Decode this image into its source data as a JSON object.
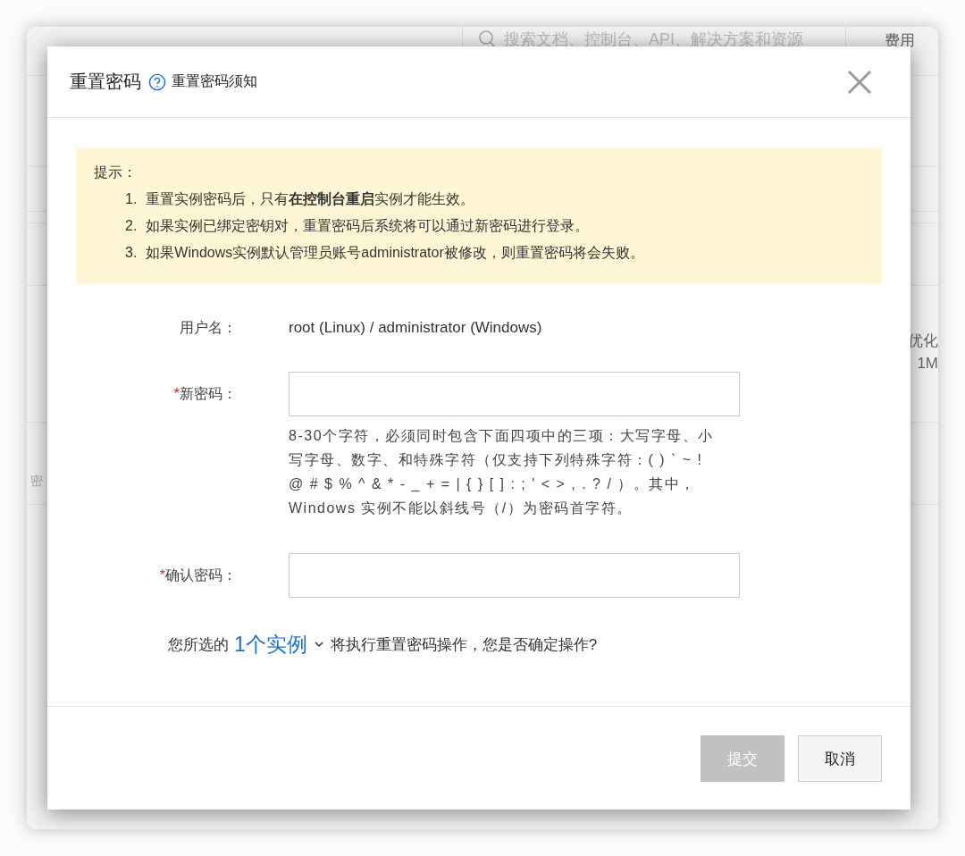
{
  "background": {
    "search_placeholder": "搜索文档、控制台、API、解决方案和资源",
    "header_link": "费用",
    "left_text": "密",
    "right_texts": [
      "优化",
      "1M"
    ]
  },
  "dialog": {
    "title": "重置密码",
    "help_link": "重置密码须知",
    "required_mark": "*",
    "notice": {
      "heading": "提示：",
      "items": [
        {
          "number": "1.",
          "text": "重置实例密码后，只有**在控制台重启**实例才能生效。"
        },
        {
          "number": "2.",
          "text": "如果实例已绑定密钥对，重置密码后系统将可以通过新密码进行登录。"
        },
        {
          "number": "3.",
          "text": "如果Windows实例默认管理员账号administrator被修改，则重置密码将会失败。"
        }
      ]
    },
    "fields": [
      {
        "kind": "text",
        "label": "用户名：",
        "required": false,
        "value": "root (Linux) / administrator (Windows)"
      },
      {
        "kind": "password",
        "label": "新密码：",
        "required": true,
        "hint": "8-30个字符，必须同时包含下面四项中的三项：大写字母、小写字母、数字、和特殊字符（仅支持下列特殊字符：( ) ` ~ ! @ # $ % ^ & * - _ + = | { } [ ] : ; ' < > , . ? / ）。其中，Windows 实例不能以斜线号（/）为密码首字符。"
      },
      {
        "kind": "password",
        "label": "确认密码：",
        "required": true
      }
    ],
    "summary": {
      "before": "您所选的",
      "link": "1个实例",
      "after": "将执行重置密码操作，您是否确定操作?"
    },
    "buttons": [
      {
        "label": "提交",
        "kind": "primary",
        "disabled": true
      },
      {
        "label": "取消",
        "kind": "secondary",
        "disabled": false
      }
    ]
  }
}
